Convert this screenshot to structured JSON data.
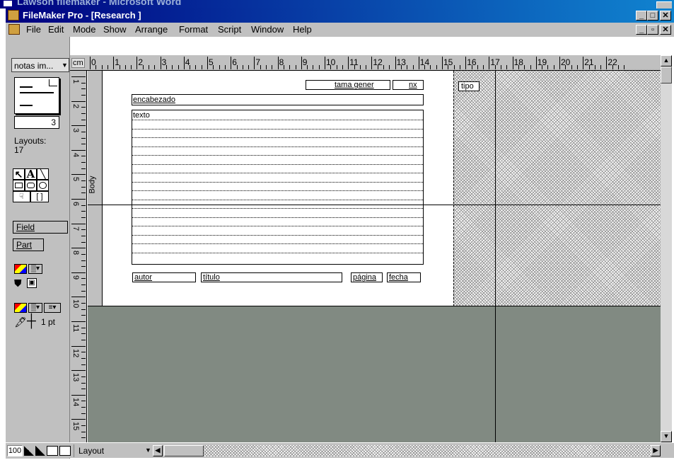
{
  "word_window": {
    "title": "Lawson filemaker - Microsoft Word"
  },
  "app_window": {
    "title": "FileMaker Pro - [Research ]"
  },
  "menu": [
    "File",
    "Edit",
    "Mode",
    "Show",
    "Arrange",
    "Format",
    "Script",
    "Window",
    "Help"
  ],
  "status_area": {
    "layout_menu": "notas im...",
    "book_number": "3",
    "layouts_label": "Layouts:",
    "layouts_count": "17",
    "field_tool": "Field",
    "part_tool": "Part",
    "pen_width": "1 pt"
  },
  "ruler": {
    "unit": "cm",
    "h_labels": [
      "0",
      "1",
      "2",
      "3",
      "4",
      "5",
      "6",
      "7",
      "8",
      "9",
      "10",
      "11",
      "12",
      "13",
      "14",
      "15",
      "16",
      "17",
      "18",
      "19",
      "20",
      "21",
      "22"
    ],
    "v_labels": [
      "1",
      "2",
      "3",
      "4",
      "5",
      "6",
      "7",
      "8",
      "9",
      "10",
      "11",
      "12",
      "13",
      "14",
      "15"
    ]
  },
  "layout": {
    "part_label": "Body",
    "fields": {
      "tama_general": "tama gener",
      "nx": "nx",
      "tipo": "tipo",
      "encabezado": "encabezado",
      "texto": "texto",
      "autor": "autor",
      "titulo": "título",
      "pagina": "página",
      "fecha": "fecha"
    }
  },
  "bottom_bar": {
    "zoom": "100",
    "mode": "Layout"
  },
  "colors": {
    "title_start": "#000080",
    "title_end": "#1084d0",
    "chrome": "#c0c0c0",
    "canvas": "#808a80"
  }
}
